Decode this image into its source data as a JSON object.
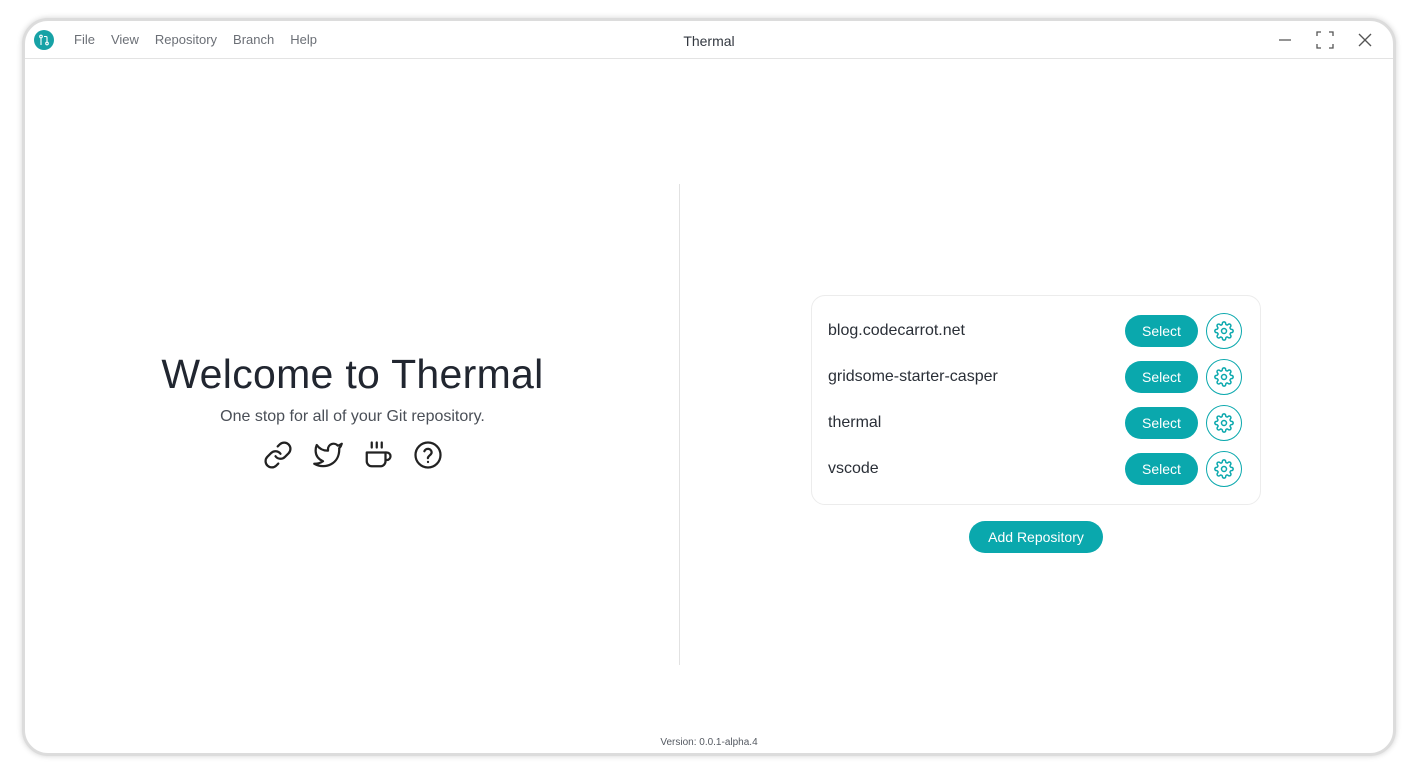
{
  "app": {
    "title": "Thermal",
    "logo_icon": "git-branch-icon",
    "accent_color": "#0aa8ad"
  },
  "menu": {
    "items": [
      "File",
      "View",
      "Repository",
      "Branch",
      "Help"
    ]
  },
  "window_controls": {
    "icons": [
      "minimize-icon",
      "maximize-icon",
      "close-icon"
    ]
  },
  "welcome": {
    "heading": "Welcome to Thermal",
    "subtitle": "One stop for all of your Git repository.",
    "links": [
      "link-icon",
      "twitter-icon",
      "coffee-icon",
      "help-icon"
    ]
  },
  "repositories": {
    "select_label": "Select",
    "items": [
      {
        "name": "blog.codecarrot.net"
      },
      {
        "name": "gridsome-starter-casper"
      },
      {
        "name": "thermal"
      },
      {
        "name": "vscode"
      }
    ],
    "add_label": "Add Repository"
  },
  "footer": {
    "version": "Version: 0.0.1-alpha.4"
  }
}
